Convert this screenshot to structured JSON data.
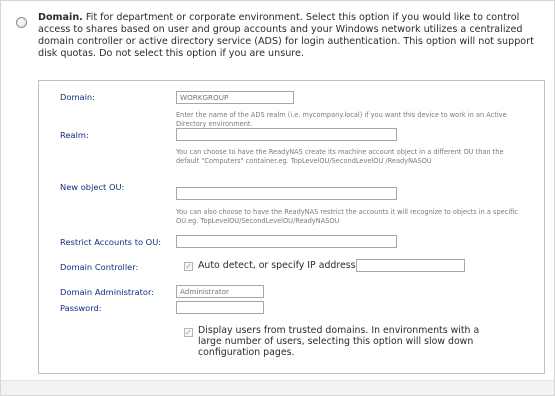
{
  "option": {
    "title": "Domain.",
    "description": "Fit for department or corporate environment. Select this option if you would like to control access to shares based on user and group accounts and your Windows network utilizes a centralized domain controller or active directory service (ADS) for login authentication. This option will not support disk quotas. Do not select this option if you are unsure."
  },
  "form": {
    "domain": {
      "label": "Domain:",
      "placeholder": "WORKGROUP"
    },
    "realm": {
      "help": "Enter the name of the ADS realm (i.e. mycompany.local) if you want this device to work in an Active Directory environment.",
      "label": "Realm:",
      "value": ""
    },
    "new_ou": {
      "help": "You can choose to have the ReadyNAS create its machine account object in a different OU than the default \"Computers\" container.eg. TopLevelOU/SecondLevelOU /ReadyNASOU",
      "label": "New object OU:",
      "value": ""
    },
    "restrict": {
      "help": "You can also choose to have the ReadyNAS restrict the accounts it will recognize to objects in a specific OU.eg. TopLevelOU/SecondLevelOU/ReadyNASOU",
      "label": "Restrict Accounts to OU:",
      "value": ""
    },
    "controller": {
      "label": "Domain Controller:",
      "checkbox_label": "Auto detect, or specify IP address:",
      "value": ""
    },
    "admin": {
      "label": "Domain Administrator:",
      "placeholder": "Administrator"
    },
    "password": {
      "label": "Password:",
      "value": ""
    },
    "trusted": {
      "checkbox_label": "Display users from trusted domains. In environments with a large number of users, selecting this option will slow down configuration pages."
    }
  },
  "colors": {
    "label": "#0f2f7a",
    "help": "#7a7a7a",
    "border": "#a7a7a7"
  },
  "icons": {
    "check": "✓"
  }
}
